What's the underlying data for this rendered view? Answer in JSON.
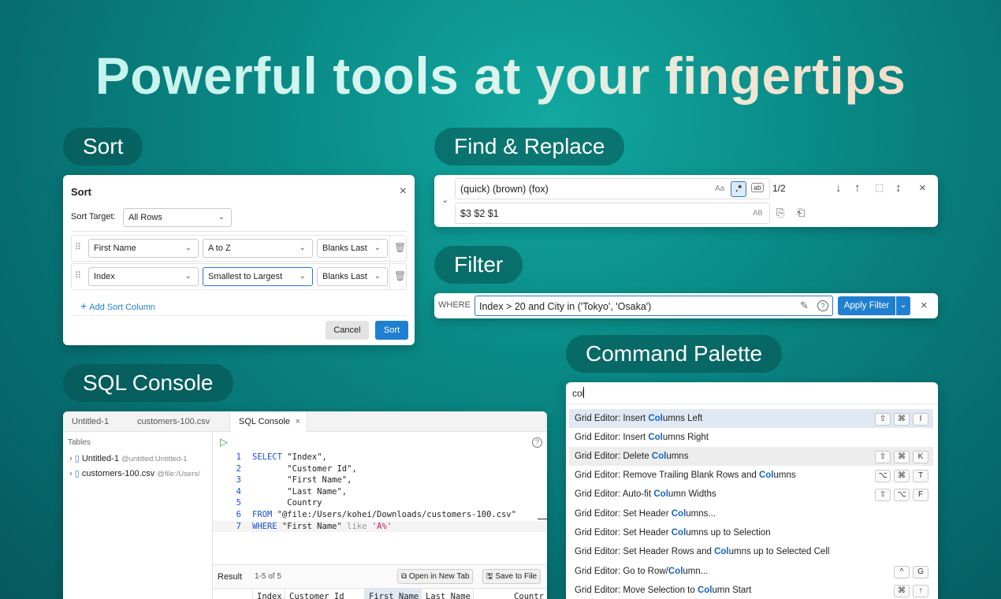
{
  "headline": "Powerful tools at your fingertips",
  "sections": {
    "sort": "Sort",
    "find": "Find & Replace",
    "filter": "Filter",
    "sql": "SQL Console",
    "palette": "Command Palette"
  },
  "sort_dialog": {
    "title": "Sort",
    "close": "×",
    "target_label": "Sort Target:",
    "target_value": "All Rows",
    "rows": [
      {
        "column": "First Name",
        "order": "A to Z",
        "blanks": "Blanks Last"
      },
      {
        "column": "Index",
        "order": "Smallest to Largest",
        "blanks": "Blanks Last"
      }
    ],
    "add_label": "Add Sort Column",
    "cancel": "Cancel",
    "submit": "Sort"
  },
  "find": {
    "search_value": "(quick) (brown) (fox)",
    "replace_value": "$3 $2 $1",
    "match_case": "Aa",
    "regex": ".*",
    "whole_word": "ab",
    "preserve_case": "AB",
    "count": "1/2"
  },
  "filter": {
    "label": "WHERE",
    "value": "Index > 20 and City in ('Tokyo', 'Osaka')",
    "apply": "Apply Filter"
  },
  "palette": {
    "query": "col",
    "items": [
      {
        "pre": "Grid Editor: Insert ",
        "hl": "Col",
        "post": "umns Left",
        "keys": [
          "⇧",
          "⌘",
          "I"
        ]
      },
      {
        "pre": "Grid Editor: Insert ",
        "hl": "Col",
        "post": "umns Right",
        "keys": []
      },
      {
        "pre": "Grid Editor: Delete ",
        "hl": "Col",
        "post": "umns",
        "keys": [
          "⇧",
          "⌘",
          "K"
        ]
      },
      {
        "pre": "Grid Editor: Remove Trailing Blank Rows and ",
        "hl": "Col",
        "post": "umns",
        "keys": [
          "⌥",
          "⌘",
          "T"
        ]
      },
      {
        "pre": "Grid Editor: Auto-fit ",
        "hl": "Col",
        "post": "umn Widths",
        "keys": [
          "⇧",
          "⌥",
          "F"
        ]
      },
      {
        "pre": "Grid Editor: Set Header ",
        "hl": "Col",
        "post": "umns...",
        "keys": []
      },
      {
        "pre": "Grid Editor: Set Header ",
        "hl": "Col",
        "post": "umns up to Selection",
        "keys": []
      },
      {
        "pre": "Grid Editor: Set Header Rows and ",
        "hl": "Col",
        "post": "umns up to Selected Cell",
        "keys": []
      },
      {
        "pre": "Grid Editor: Go to Row/",
        "hl": "Col",
        "post": "umn...",
        "keys": [
          "^",
          "G"
        ]
      },
      {
        "pre": "Grid Editor: Move Selection to ",
        "hl": "Col",
        "post": "umn Start",
        "keys": [
          "⌘",
          "↑"
        ]
      }
    ]
  },
  "sql": {
    "tabs": [
      "Untitled-1",
      "customers-100.csv",
      "SQL Console"
    ],
    "tables_label": "Tables",
    "tables": [
      {
        "name": "Untitled-1",
        "path": "@untitled:Untitled-1"
      },
      {
        "name": "customers-100.csv",
        "path": "@file:/Users/"
      }
    ],
    "code": [
      {
        "n": "1",
        "parts": [
          {
            "t": "SELECT",
            "c": "kw"
          },
          {
            "t": " \"Index\",",
            "c": ""
          }
        ]
      },
      {
        "n": "2",
        "parts": [
          {
            "t": "       \"Customer Id\",",
            "c": ""
          }
        ]
      },
      {
        "n": "3",
        "parts": [
          {
            "t": "       \"First Name\",",
            "c": ""
          }
        ]
      },
      {
        "n": "4",
        "parts": [
          {
            "t": "       \"Last Name\",",
            "c": ""
          }
        ]
      },
      {
        "n": "5",
        "parts": [
          {
            "t": "       Country",
            "c": ""
          }
        ]
      },
      {
        "n": "6",
        "parts": [
          {
            "t": "FROM",
            "c": "kw"
          },
          {
            "t": " \"@file:/Users/kohei/Downloads/customers-100.csv\"",
            "c": ""
          }
        ]
      },
      {
        "n": "7",
        "parts": [
          {
            "t": "WHERE",
            "c": "kw"
          },
          {
            "t": " \"First Name\" ",
            "c": ""
          },
          {
            "t": "like",
            "c": "kw2"
          },
          {
            "t": " ",
            "c": ""
          },
          {
            "t": "'A%'",
            "c": "str"
          }
        ]
      }
    ],
    "result_label": "Result",
    "result_range": "1-5 of 5",
    "open_new_tab": "Open in New Tab",
    "save_to_file": "Save to File",
    "columns": [
      "Index",
      "Customer Id",
      "First Name",
      "Last Name",
      "Countr"
    ]
  },
  "colors": {
    "accent": "#1f7fd1",
    "teal": "#0a8a86"
  }
}
